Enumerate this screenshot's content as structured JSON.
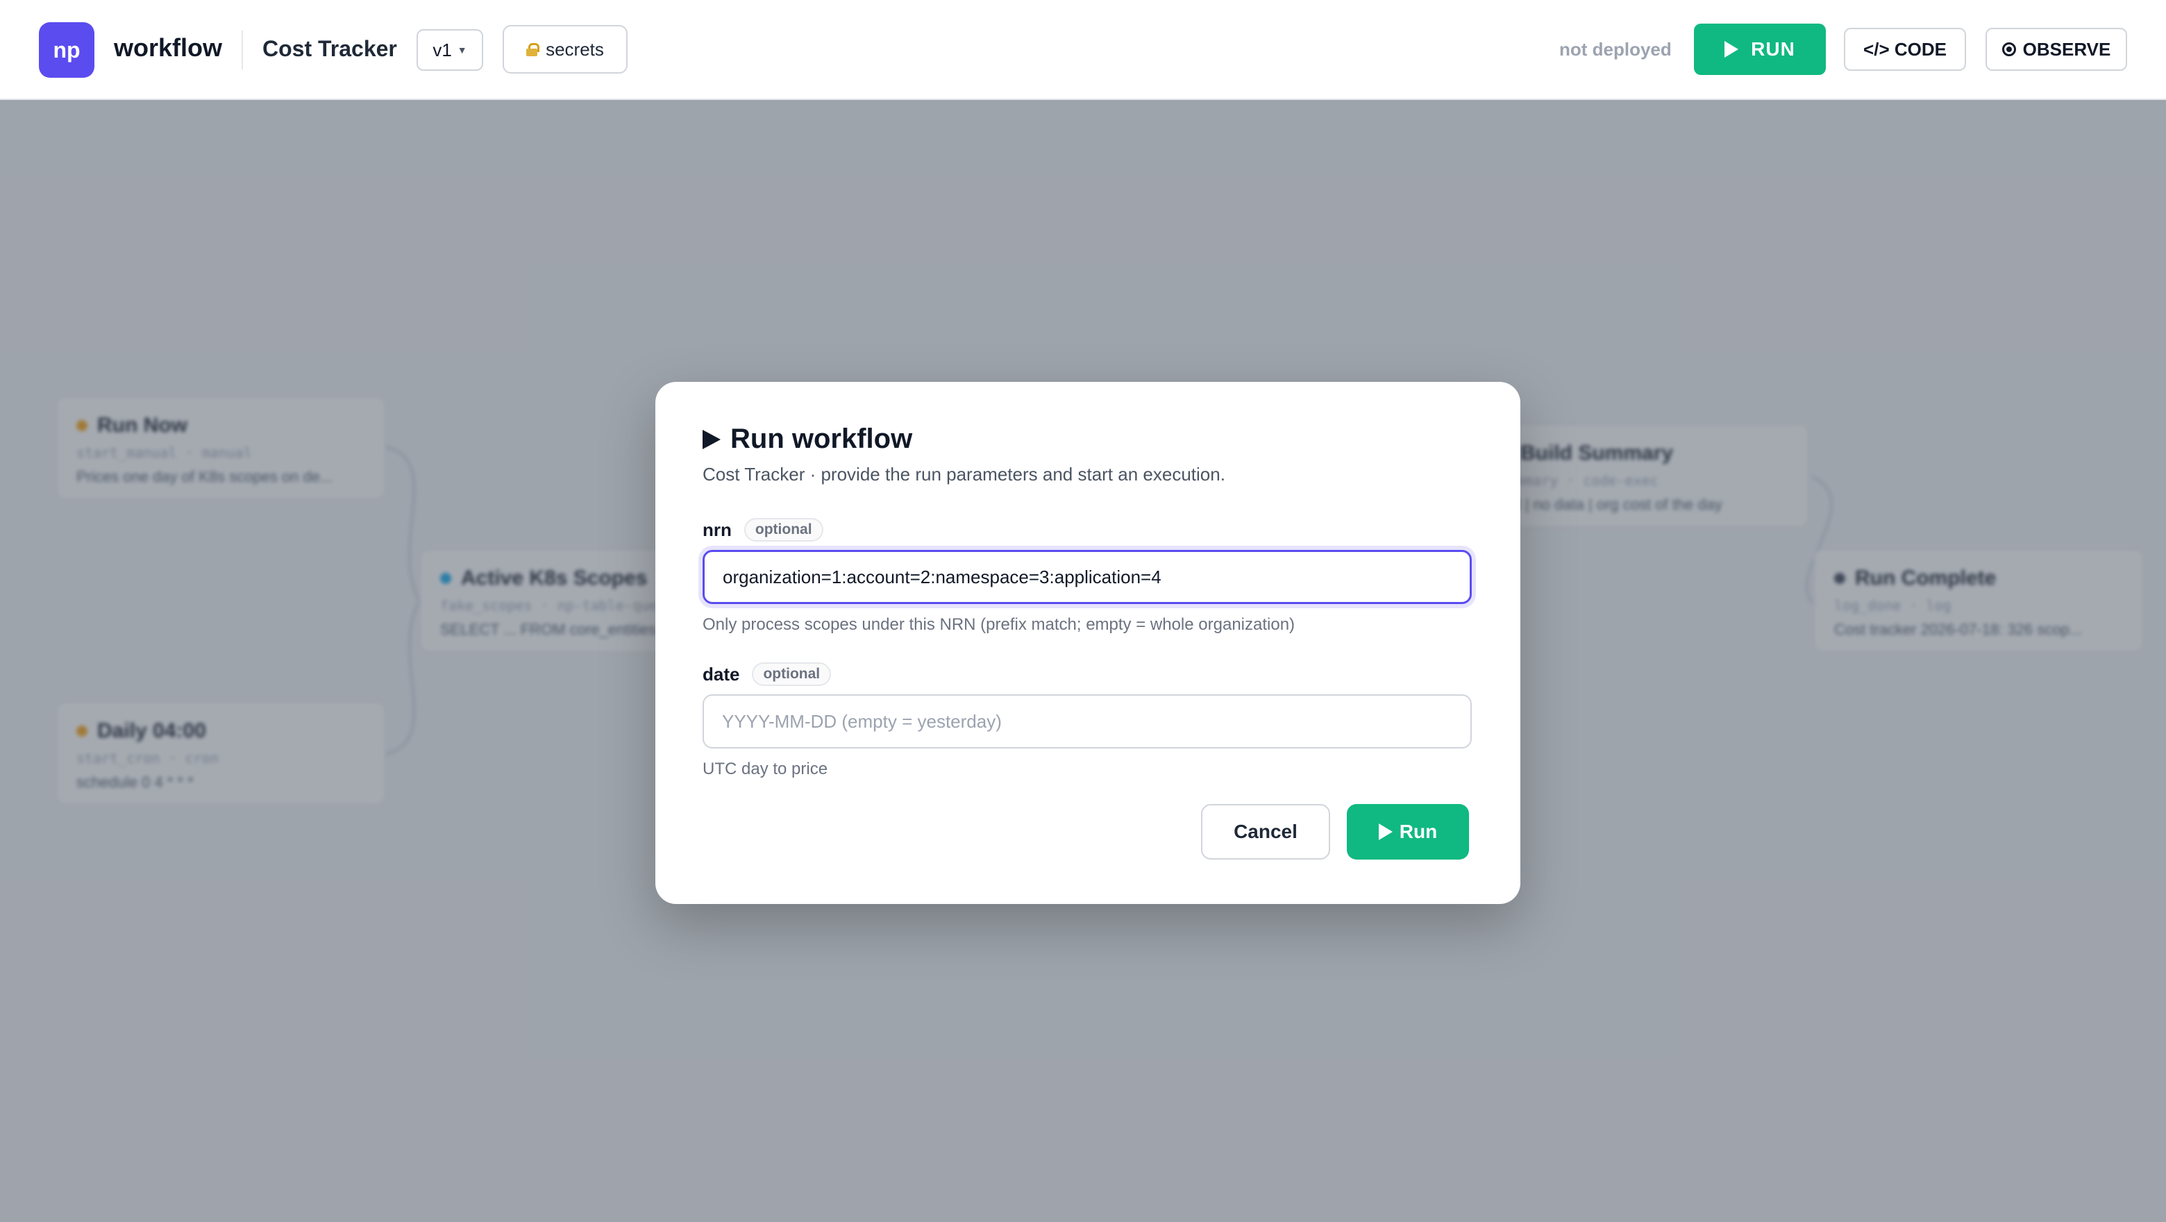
{
  "header": {
    "logo_text": "np",
    "app_name": "workflow",
    "workflow_title": "Cost Tracker",
    "version_label": "v1",
    "secrets_label": "secrets",
    "deploy_status": "not deployed",
    "run_label": "RUN",
    "code_label": "</> CODE",
    "observe_label": "OBSERVE"
  },
  "canvas": {
    "nodes": [
      {
        "title": "Run Now",
        "meta": "start_manual · manual",
        "desc": "Prices one day of K8s scopes on de...",
        "dot_color": "#f59e0b"
      },
      {
        "title": "Daily 04:00",
        "meta": "start_cron · cron",
        "desc": "schedule 0 4 * * *",
        "dot_color": "#f59e0b"
      },
      {
        "title": "Active K8s Scopes",
        "meta": "fake_scopes · np-table-query",
        "desc": "SELECT ... FROM core_entities",
        "dot_color": "#0ea5e9"
      },
      {
        "title": "Build Summary",
        "meta": "summary · code-exec",
        "desc": "ted | no data | org cost of the day",
        "dot_color": "#6366f1"
      },
      {
        "title": "Run Complete",
        "meta": "log_done · log",
        "desc": "Cost tracker 2026-07-18: 326 scop...",
        "dot_color": "#374151"
      }
    ]
  },
  "modal": {
    "title": "Run workflow",
    "subtitle": "Cost Tracker · provide the run parameters and start an execution.",
    "fields": [
      {
        "label": "nrn",
        "badge": "optional",
        "value": "organization=1:account=2:namespace=3:application=4",
        "placeholder": "",
        "help": "Only process scopes under this NRN (prefix match; empty = whole organization)"
      },
      {
        "label": "date",
        "badge": "optional",
        "value": "",
        "placeholder": "YYYY-MM-DD (empty = yesterday)",
        "help": "UTC day to price"
      }
    ],
    "cancel_label": "Cancel",
    "run_label": "Run"
  },
  "colors": {
    "accent": "#5b4cf0",
    "run_green": "#10b981",
    "overlay": "rgba(75,85,99,0.5)"
  }
}
